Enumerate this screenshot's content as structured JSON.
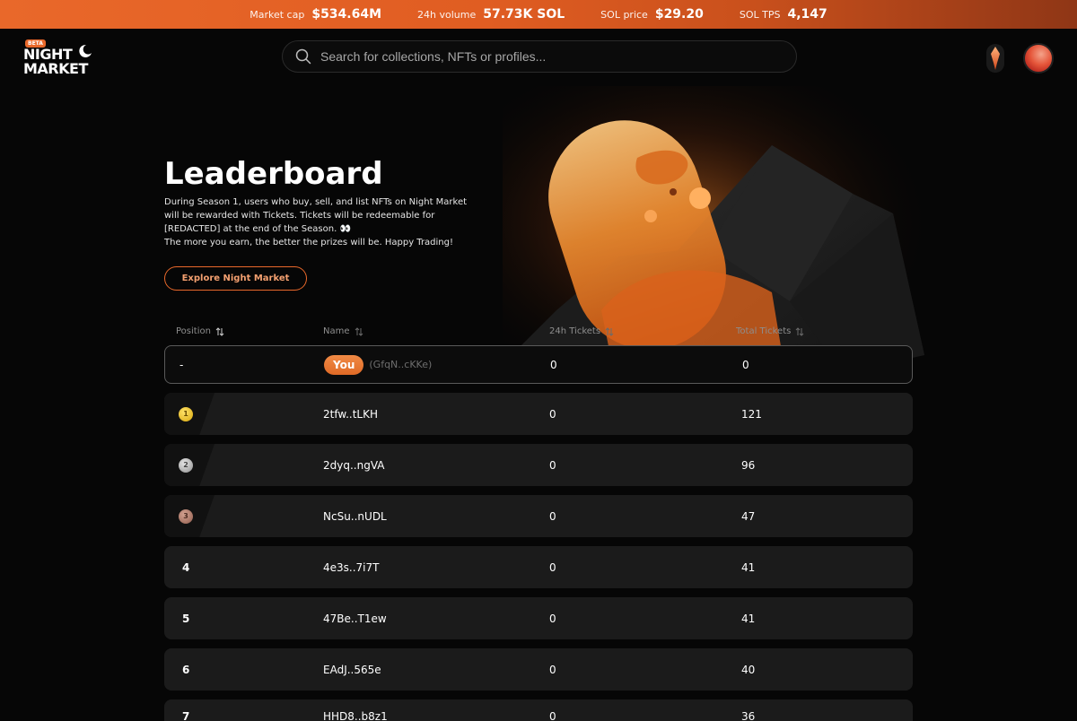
{
  "topbar": {
    "stats": [
      {
        "label": "Market cap",
        "value": "$534.64M"
      },
      {
        "label": "24h volume",
        "value": "57.73K SOL"
      },
      {
        "label": "SOL price",
        "value": "$29.20"
      },
      {
        "label": "SOL TPS",
        "value": "4,147"
      }
    ]
  },
  "header": {
    "logo_badge": "BETA",
    "logo_line1": "NIGHT",
    "logo_line2": "MARKET",
    "search_placeholder": "Search for collections, NFTs or profiles..."
  },
  "hero": {
    "title": "Leaderboard",
    "desc_line1": "During Season 1, users who buy, sell, and list NFTs on Night Market will be rewarded with Tickets. Tickets will be redeemable for [REDACTED] at the end of the Season. 👀",
    "desc_line2": "The more you earn, the better the prizes will be. Happy Trading!",
    "explore_label": "Explore Night Market"
  },
  "table": {
    "headers": {
      "position": "Position",
      "name": "Name",
      "tickets_24h": "24h Tickets",
      "total": "Total Tickets"
    },
    "you_row": {
      "position": "-",
      "badge": "You",
      "address": "(GfqN..cKKe)",
      "tickets_24h": "0",
      "total": "0"
    },
    "rows": [
      {
        "position": "1",
        "name": "2tfw..tLKH",
        "tickets_24h": "0",
        "total": "121"
      },
      {
        "position": "2",
        "name": "2dyq..ngVA",
        "tickets_24h": "0",
        "total": "96"
      },
      {
        "position": "3",
        "name": "NcSu..nUDL",
        "tickets_24h": "0",
        "total": "47"
      },
      {
        "position": "4",
        "name": "4e3s..7i7T",
        "tickets_24h": "0",
        "total": "41"
      },
      {
        "position": "5",
        "name": "47Be..T1ew",
        "tickets_24h": "0",
        "total": "41"
      },
      {
        "position": "6",
        "name": "EAdJ..565e",
        "tickets_24h": "0",
        "total": "40"
      },
      {
        "position": "7",
        "name": "HHD8..b8z1",
        "tickets_24h": "0",
        "total": "36"
      }
    ]
  },
  "colors": {
    "accent": "#e9682a",
    "background": "#060606",
    "row": "#1b1b1b"
  }
}
